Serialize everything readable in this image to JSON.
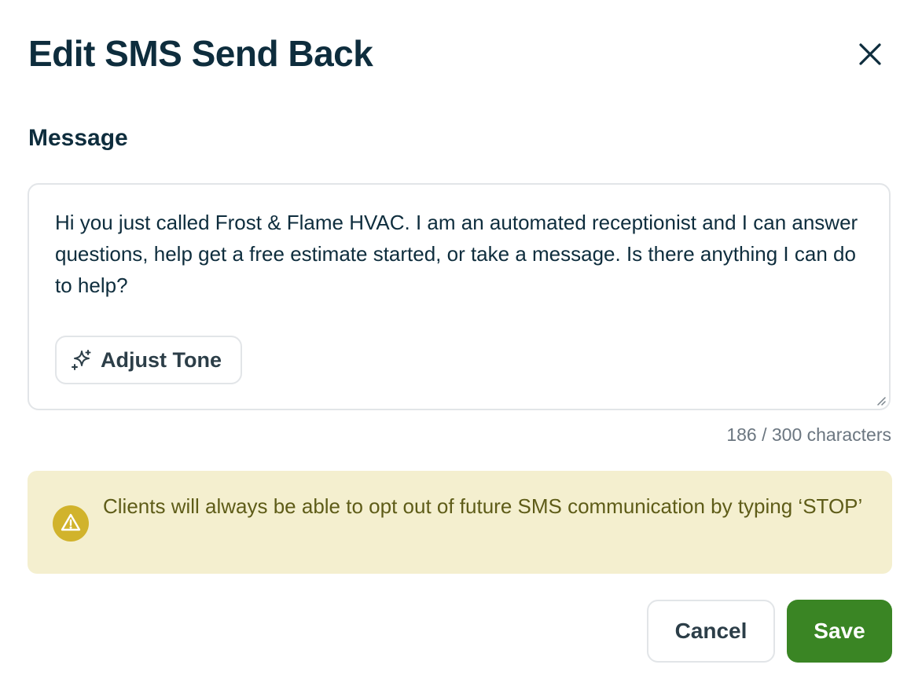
{
  "dialog": {
    "title": "Edit SMS Send Back",
    "close_icon": "close-icon"
  },
  "message": {
    "label": "Message",
    "text": "Hi you just called Frost & Flame HVAC. I am an automated receptionist and I can answer questions, help get a free estimate started, or take a message. Is there anything I can do to help?",
    "adjust_tone_label": "Adjust Tone",
    "adjust_tone_icon": "sparkles-icon",
    "char_count": "186 / 300 characters"
  },
  "notice": {
    "icon": "warning-icon",
    "text": "Clients will always be able to opt out of future SMS communication by typing ‘STOP’"
  },
  "actions": {
    "cancel_label": "Cancel",
    "save_label": "Save"
  },
  "colors": {
    "primary_text": "#0e2d3d",
    "save_button": "#3a8524",
    "notice_background": "#f4efcf",
    "notice_text": "#5e5c18",
    "warning_icon": "#d1b32c"
  }
}
